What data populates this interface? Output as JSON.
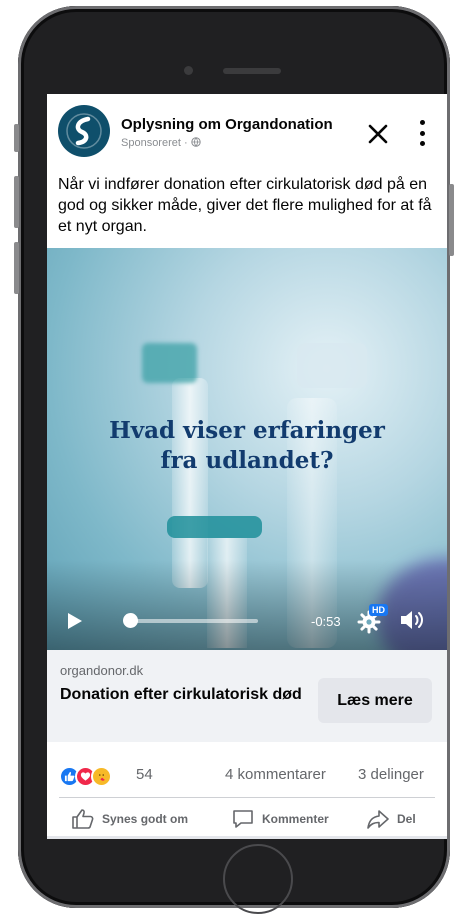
{
  "post": {
    "page_name": "Oplysning om Organdonation",
    "sponsored_label": "Sponsoreret · ",
    "text": "Når vi indfører donation efter cirkulatorisk død på en god og sikker måde, giver det flere mulighed for at få et nyt organ."
  },
  "video": {
    "caption_line1": "Hvad viser erfaringer",
    "caption_line2": "fra udlandet?",
    "time_remaining": "-0:53",
    "quality_badge": "HD",
    "progress_fraction": 0.06
  },
  "link": {
    "domain": "organdonor.dk",
    "title": "Donation efter cirkulatorisk død",
    "cta_label": "Læs mere"
  },
  "engagement": {
    "reaction_icons": [
      "like-reaction-icon",
      "love-reaction-icon",
      "care-reaction-icon"
    ],
    "reaction_count": "54",
    "comments": "4 kommentarer",
    "shares": "3 delinger"
  },
  "actions": {
    "like_label": "Synes godt om",
    "comment_label": "Kommenter",
    "share_label": "Del"
  },
  "colors": {
    "brand_avatar": "#0f4f6b",
    "facebook_blue": "#1877f2",
    "caption_text": "#123b6e"
  }
}
